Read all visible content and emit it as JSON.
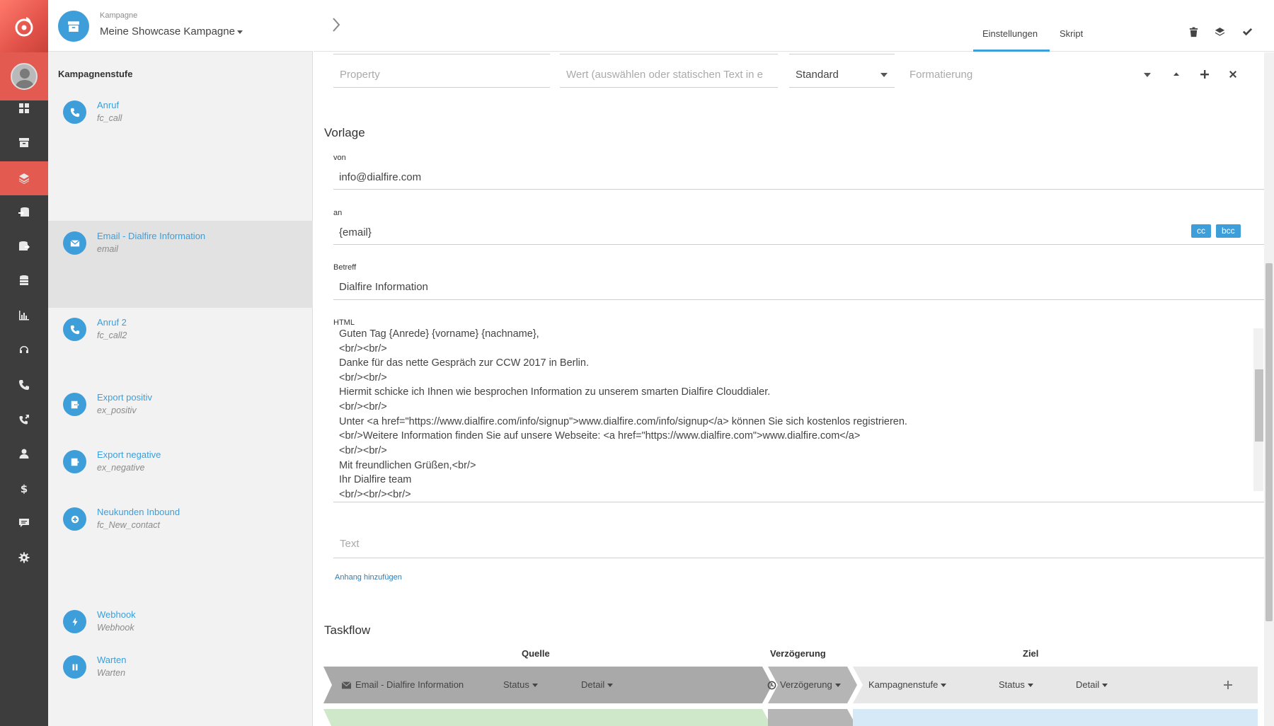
{
  "campaign": {
    "label": "Kampagne",
    "name": "Meine Showcase Kampagne"
  },
  "steps_title": "Kampagnenstufe",
  "steps": [
    {
      "name": "Anruf",
      "code": "fc_call",
      "icon": "phone-icon"
    },
    {
      "name": "Email - Dialfire Information",
      "code": "email",
      "icon": "envelope-icon"
    },
    {
      "name": "Anruf 2",
      "code": "fc_call2",
      "icon": "phone-icon"
    },
    {
      "name": "Export positiv",
      "code": "ex_positiv",
      "icon": "export-icon"
    },
    {
      "name": "Export negative",
      "code": "ex_negative",
      "icon": "export-icon"
    },
    {
      "name": "Neukunden Inbound",
      "code": "fc_New_contact",
      "icon": "plus-circle-icon"
    },
    {
      "name": "Webhook",
      "code": "Webhook",
      "icon": "bolt-icon"
    },
    {
      "name": "Warten",
      "code": "Warten",
      "icon": "pause-icon"
    }
  ],
  "tabs": {
    "settings": "Einstellungen",
    "script": "Skript"
  },
  "property_row": {
    "property_placeholder": "Property",
    "value_placeholder": "Wert (auswählen oder statischen Text in e",
    "format_select": "Standard",
    "formatting_placeholder": "Formatierung"
  },
  "template": {
    "title": "Vorlage",
    "from_label": "von",
    "from_value": "info@dialfire.com",
    "to_label": "an",
    "to_value": "{email}",
    "cc": "cc",
    "bcc": "bcc",
    "subject_label": "Betreff",
    "subject_value": "Dialfire Information",
    "html_label": "HTML",
    "html_lines": [
      "Guten Tag {Anrede} {vorname} {nachname},",
      "<br/><br/>",
      "Danke für das nette Gespräch zur CCW 2017 in Berlin.",
      "<br/><br/>",
      "Hiermit schicke ich Ihnen wie besprochen Information zu unserem smarten Dialfire Clouddialer.",
      "<br/><br/>",
      "Unter <a href=\"https://www.dialfire.com/info/signup\">www.dialfire.com/info/signup</a> können Sie sich kostenlos registrieren.",
      "<br/>Weitere Information finden Sie auf unsere Webseite: <a href=\"https://www.dialfire.com\">www.dialfire.com</a>",
      "<br/><br/>",
      "Mit freundlichen Grüßen,<br/>",
      "Ihr Dialfire team",
      "<br/><br/><br/>"
    ],
    "text_placeholder": "Text",
    "attachment_link": "Anhang hinzufügen"
  },
  "taskflow": {
    "title": "Taskflow",
    "col_source": "Quelle",
    "col_delay": "Verzögerung",
    "col_target": "Ziel",
    "header_row": {
      "source_step": "Email - Dialfire Information",
      "status": "Status",
      "detail": "Detail",
      "delay": "Verzögerung",
      "target_step": "Kampagnenstufe",
      "target_status": "Status",
      "target_detail": "Detail"
    }
  }
}
